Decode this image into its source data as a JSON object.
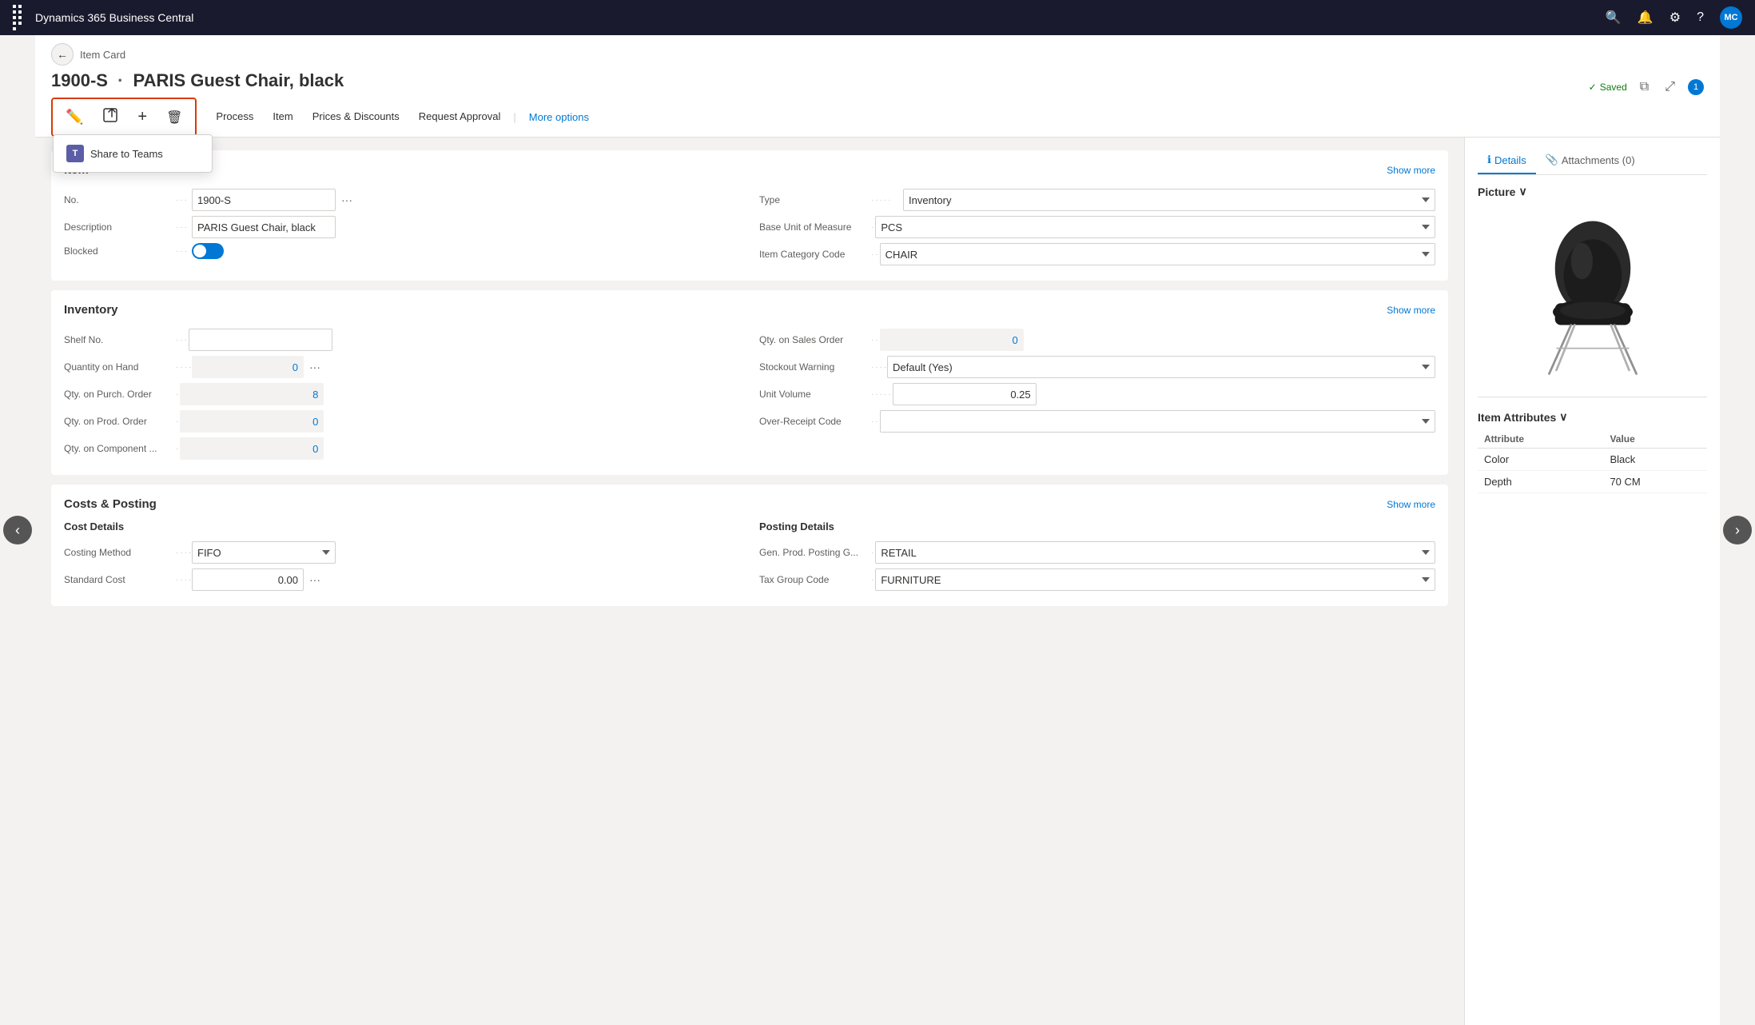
{
  "topNav": {
    "appTitle": "Dynamics 365 Business Central",
    "avatarInitials": "MC"
  },
  "header": {
    "breadcrumb": "Item Card",
    "title": "1900-S",
    "titleSeparator": "·",
    "titleDescription": "PARIS Guest Chair, black",
    "savedText": "Saved",
    "infoBadge": "1"
  },
  "toolbar": {
    "editIcon": "✏",
    "shareIcon": "↗",
    "addIcon": "+",
    "deleteIcon": "🗑",
    "shareToTeamsLabel": "Share to Teams",
    "tabs": [
      {
        "label": "Process"
      },
      {
        "label": "Item"
      },
      {
        "label": "Prices & Discounts"
      },
      {
        "label": "Request Approval"
      }
    ],
    "moreOptions": "More options"
  },
  "formSections": {
    "item": {
      "title": "Item",
      "showMore": "Show more",
      "fields": {
        "no": {
          "label": "No.",
          "value": "1900-S"
        },
        "description": {
          "label": "Description",
          "value": "PARIS Guest Chair, black"
        },
        "blocked": {
          "label": "Blocked"
        },
        "type": {
          "label": "Type",
          "value": "Inventory"
        },
        "baseUnitOfMeasure": {
          "label": "Base Unit of Measure",
          "value": "PCS"
        },
        "itemCategoryCode": {
          "label": "Item Category Code",
          "value": "CHAIR"
        }
      }
    },
    "inventory": {
      "title": "Inventory",
      "showMore": "Show more",
      "fields": {
        "shelfNo": {
          "label": "Shelf No.",
          "value": ""
        },
        "quantityOnHand": {
          "label": "Quantity on Hand",
          "value": "0"
        },
        "qtyOnPurchOrder": {
          "label": "Qty. on Purch. Order",
          "value": "8"
        },
        "qtyOnProdOrder": {
          "label": "Qty. on Prod. Order",
          "value": "0"
        },
        "qtyOnComponent": {
          "label": "Qty. on Component ...",
          "value": "0"
        },
        "qtyOnSalesOrder": {
          "label": "Qty. on Sales Order",
          "value": "0"
        },
        "stockoutWarning": {
          "label": "Stockout Warning",
          "value": "Default (Yes)"
        },
        "unitVolume": {
          "label": "Unit Volume",
          "value": "0.25"
        },
        "overReceiptCode": {
          "label": "Over-Receipt Code",
          "value": ""
        }
      }
    },
    "costsPosting": {
      "title": "Costs & Posting",
      "showMore": "Show more",
      "costDetails": "Cost Details",
      "postingDetails": "Posting Details",
      "fields": {
        "costingMethod": {
          "label": "Costing Method",
          "value": "FIFO"
        },
        "standardCost": {
          "label": "Standard Cost",
          "value": "0.00"
        },
        "genProdPostingGroup": {
          "label": "Gen. Prod. Posting G...",
          "value": "RETAIL"
        },
        "taxGroupCode": {
          "label": "Tax Group Code",
          "value": "FURNITURE"
        }
      }
    }
  },
  "sidePanel": {
    "tabs": [
      {
        "label": "Details",
        "icon": "ℹ",
        "active": true
      },
      {
        "label": "Attachments (0)",
        "icon": "📎",
        "active": false
      }
    ],
    "picture": {
      "title": "Picture",
      "chevron": "∨"
    },
    "itemAttributes": {
      "title": "Item Attributes",
      "chevron": "∨",
      "columns": [
        "Attribute",
        "Value"
      ],
      "rows": [
        {
          "attribute": "Color",
          "value": "Black"
        },
        {
          "attribute": "Depth",
          "value": "70 CM"
        }
      ]
    }
  }
}
